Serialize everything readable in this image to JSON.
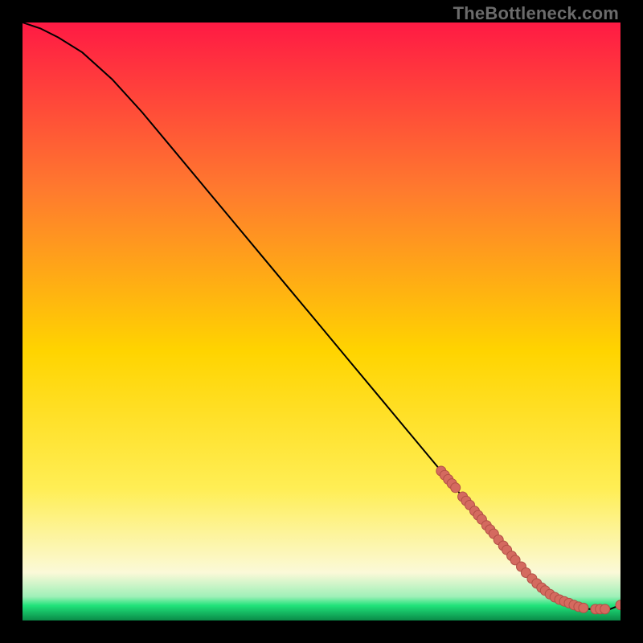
{
  "watermark": "TheBottleneck.com",
  "colors": {
    "background": "#000000",
    "gradient_top": "#ff1a44",
    "gradient_mid_upper": "#ff7a2e",
    "gradient_mid": "#ffd400",
    "gradient_mid_lower": "#ffee55",
    "gradient_pale": "#fbf9d8",
    "gradient_green": "#20e37a",
    "curve": "#000000",
    "marker_fill": "#d46a5f",
    "marker_stroke": "#b24f46"
  },
  "chart_data": {
    "type": "line",
    "title": "",
    "xlabel": "",
    "ylabel": "",
    "xlim": [
      0,
      100
    ],
    "ylim": [
      0,
      100
    ],
    "grid": false,
    "legend": false,
    "series": [
      {
        "name": "bottleneck-curve",
        "x": [
          0,
          3,
          6,
          10,
          15,
          20,
          25,
          30,
          35,
          40,
          45,
          50,
          55,
          60,
          65,
          70,
          75,
          80,
          82,
          84,
          86,
          88,
          90,
          92,
          94,
          96,
          98,
          100
        ],
        "y": [
          100,
          99,
          97.5,
          95,
          90.5,
          85,
          79,
          73,
          67,
          61,
          55,
          49,
          43,
          37,
          31,
          25,
          19,
          13,
          10.5,
          8.2,
          6.2,
          4.6,
          3.4,
          2.5,
          2.0,
          1.8,
          1.8,
          2.6
        ]
      }
    ],
    "markers": [
      {
        "x": 70.0,
        "y": 25.0
      },
      {
        "x": 70.6,
        "y": 24.3
      },
      {
        "x": 71.2,
        "y": 23.6
      },
      {
        "x": 71.8,
        "y": 22.9
      },
      {
        "x": 72.4,
        "y": 22.2
      },
      {
        "x": 73.6,
        "y": 20.7
      },
      {
        "x": 74.2,
        "y": 20.0
      },
      {
        "x": 74.8,
        "y": 19.3
      },
      {
        "x": 75.6,
        "y": 18.3
      },
      {
        "x": 76.2,
        "y": 17.6
      },
      {
        "x": 76.8,
        "y": 16.9
      },
      {
        "x": 77.6,
        "y": 15.9
      },
      {
        "x": 78.2,
        "y": 15.2
      },
      {
        "x": 78.8,
        "y": 14.5
      },
      {
        "x": 79.6,
        "y": 13.5
      },
      {
        "x": 80.4,
        "y": 12.5
      },
      {
        "x": 81.0,
        "y": 11.8
      },
      {
        "x": 81.8,
        "y": 10.8
      },
      {
        "x": 82.4,
        "y": 10.1
      },
      {
        "x": 83.4,
        "y": 9.0
      },
      {
        "x": 84.2,
        "y": 8.0
      },
      {
        "x": 85.2,
        "y": 7.0
      },
      {
        "x": 86.0,
        "y": 6.2
      },
      {
        "x": 86.8,
        "y": 5.5
      },
      {
        "x": 87.4,
        "y": 5.0
      },
      {
        "x": 88.2,
        "y": 4.4
      },
      {
        "x": 89.0,
        "y": 3.9
      },
      {
        "x": 89.8,
        "y": 3.5
      },
      {
        "x": 90.6,
        "y": 3.2
      },
      {
        "x": 91.4,
        "y": 2.9
      },
      {
        "x": 92.2,
        "y": 2.6
      },
      {
        "x": 93.0,
        "y": 2.3
      },
      {
        "x": 93.8,
        "y": 2.1
      },
      {
        "x": 95.8,
        "y": 1.9
      },
      {
        "x": 96.6,
        "y": 1.9
      },
      {
        "x": 97.4,
        "y": 1.9
      },
      {
        "x": 100.0,
        "y": 2.6
      }
    ]
  }
}
